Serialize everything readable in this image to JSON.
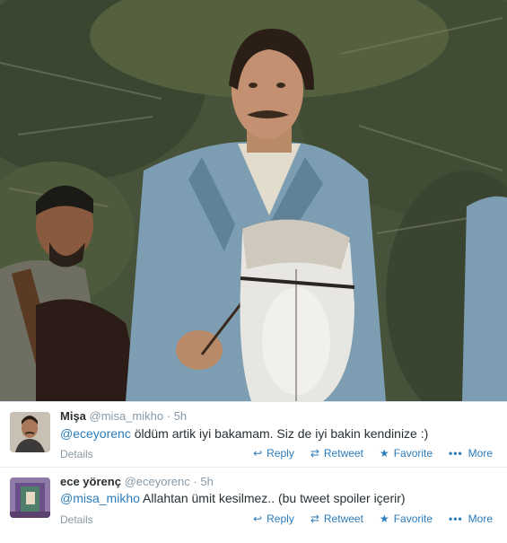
{
  "photo": {
    "description_icon": "photo-image"
  },
  "tweets": [
    {
      "name": "Mişa",
      "handle": "@misa_mikho",
      "separator": "·",
      "time": "5h",
      "mention": "@eceyorenc",
      "text": " öldüm artik iyi bakamam. Siz de iyi bakin kendinize :)",
      "details": "Details",
      "actions": {
        "reply": "Reply",
        "retweet": "Retweet",
        "favorite": "Favorite",
        "more": "More"
      }
    },
    {
      "name": "ece yörenç",
      "handle": "@eceyorenc",
      "separator": "·",
      "time": "5h",
      "mention": "@misa_mikho",
      "text": " Allahtan ümit kesilmez.. (bu tweet spoiler içerir)",
      "details": "Details",
      "actions": {
        "reply": "Reply",
        "retweet": "Retweet",
        "favorite": "Favorite",
        "more": "More"
      }
    }
  ],
  "colors": {
    "link": "#2b7bb9",
    "muted": "#8899a6",
    "text": "#292f33"
  }
}
